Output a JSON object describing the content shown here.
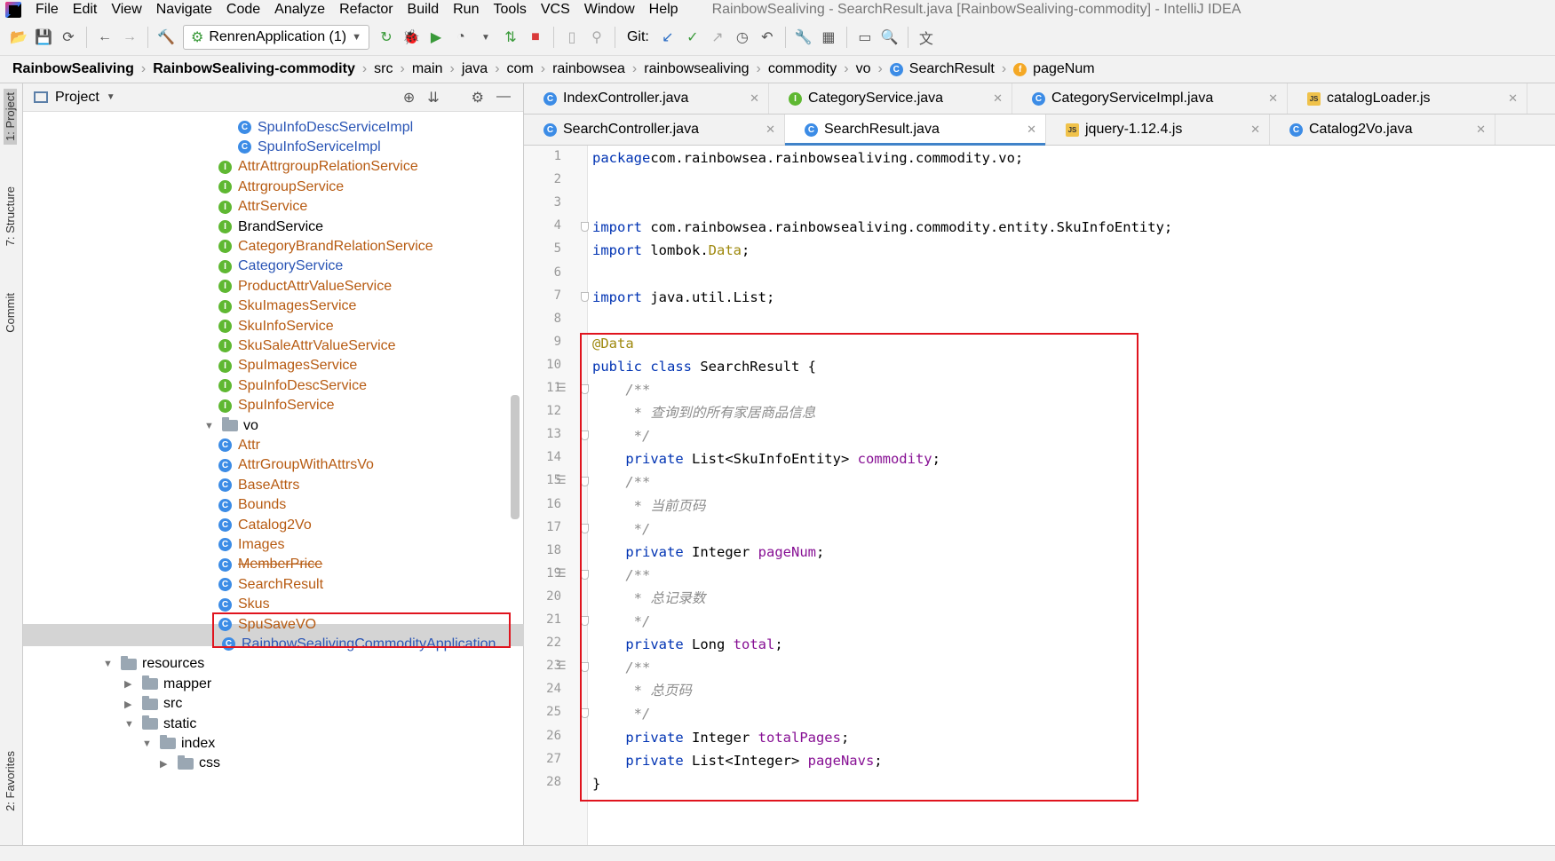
{
  "menubar": {
    "items": [
      "File",
      "Edit",
      "View",
      "Navigate",
      "Code",
      "Analyze",
      "Refactor",
      "Build",
      "Run",
      "Tools",
      "VCS",
      "Window",
      "Help"
    ],
    "window_title": "RainbowSealiving - SearchResult.java [RainbowSealiving-commodity] - IntelliJ IDEA"
  },
  "toolbar": {
    "run_config": "RenrenApplication (1)",
    "git_label": "Git:"
  },
  "breadcrumb": [
    "RainbowSealiving",
    "RainbowSealiving-commodity",
    "src",
    "main",
    "java",
    "com",
    "rainbowsea",
    "rainbowsealiving",
    "commodity",
    "vo",
    "SearchResult",
    "pageNum"
  ],
  "left_tool": {
    "project_tab": "1: Project",
    "structure_tab": "7: Structure",
    "commit_tab": "Commit",
    "favorites_tab": "2: Favorites"
  },
  "project_panel": {
    "title": "Project",
    "tree": [
      {
        "name": "SpuInfoDescServiceImpl",
        "kind": "class",
        "indent": 3,
        "arrow": ""
      },
      {
        "name": "SpuInfoServiceImpl",
        "kind": "class",
        "indent": 3,
        "arrow": ""
      },
      {
        "name": "AttrAttrgroupRelationService",
        "kind": "interface",
        "indent": 2,
        "arrow": ""
      },
      {
        "name": "AttrgroupService",
        "kind": "interface",
        "indent": 2,
        "arrow": ""
      },
      {
        "name": "AttrService",
        "kind": "interface",
        "indent": 2,
        "arrow": ""
      },
      {
        "name": "BrandService",
        "kind": "interface",
        "indent": 2,
        "arrow": "",
        "color": "black"
      },
      {
        "name": "CategoryBrandRelationService",
        "kind": "interface",
        "indent": 2,
        "arrow": ""
      },
      {
        "name": "CategoryService",
        "kind": "interface",
        "indent": 2,
        "arrow": "",
        "color": "blue"
      },
      {
        "name": "ProductAttrValueService",
        "kind": "interface",
        "indent": 2,
        "arrow": ""
      },
      {
        "name": "SkuImagesService",
        "kind": "interface",
        "indent": 2,
        "arrow": ""
      },
      {
        "name": "SkuInfoService",
        "kind": "interface",
        "indent": 2,
        "arrow": ""
      },
      {
        "name": "SkuSaleAttrValueService",
        "kind": "interface",
        "indent": 2,
        "arrow": ""
      },
      {
        "name": "SpuImagesService",
        "kind": "interface",
        "indent": 2,
        "arrow": ""
      },
      {
        "name": "SpuInfoDescService",
        "kind": "interface",
        "indent": 2,
        "arrow": ""
      },
      {
        "name": "SpuInfoService",
        "kind": "interface",
        "indent": 2,
        "arrow": ""
      },
      {
        "name": "vo",
        "kind": "folder",
        "indent": 1,
        "arrow": "▼"
      },
      {
        "name": "Attr",
        "kind": "class",
        "indent": 2,
        "arrow": ""
      },
      {
        "name": "AttrGroupWithAttrsVo",
        "kind": "class",
        "indent": 2,
        "arrow": ""
      },
      {
        "name": "BaseAttrs",
        "kind": "class",
        "indent": 2,
        "arrow": ""
      },
      {
        "name": "Bounds",
        "kind": "class",
        "indent": 2,
        "arrow": ""
      },
      {
        "name": "Catalog2Vo",
        "kind": "class",
        "indent": 2,
        "arrow": ""
      },
      {
        "name": "Images",
        "kind": "class",
        "indent": 2,
        "arrow": ""
      },
      {
        "name": "MemberPrice",
        "kind": "class",
        "indent": 2,
        "arrow": ""
      },
      {
        "name": "SearchResult",
        "kind": "class",
        "indent": 2,
        "arrow": "",
        "selected": true
      },
      {
        "name": "Skus",
        "kind": "class",
        "indent": 2,
        "arrow": ""
      },
      {
        "name": "SpuSaveVO",
        "kind": "class",
        "indent": 2,
        "arrow": ""
      },
      {
        "name": "RainbowSealivingCommodityApplication",
        "kind": "class",
        "indent": 1,
        "arrow": "",
        "color": "blue"
      },
      {
        "name": "resources",
        "kind": "folder",
        "indent": 0,
        "arrow": "▼",
        "color": "black"
      },
      {
        "name": "mapper",
        "kind": "folder",
        "indent": 1,
        "arrow": "▶",
        "color": "black"
      },
      {
        "name": "src",
        "kind": "folder",
        "indent": 1,
        "arrow": "▶",
        "color": "black"
      },
      {
        "name": "static",
        "kind": "folder",
        "indent": 1,
        "arrow": "▼",
        "color": "black"
      },
      {
        "name": "index",
        "kind": "folder",
        "indent": 2,
        "arrow": "▼",
        "color": "black"
      },
      {
        "name": "css",
        "kind": "folder",
        "indent": 3,
        "arrow": "▶",
        "color": "black"
      }
    ]
  },
  "editor_tabs_row1": [
    {
      "label": "IndexController.java",
      "icon": "class-icon"
    },
    {
      "label": "CategoryService.java",
      "icon": "interface-icon"
    },
    {
      "label": "CategoryServiceImpl.java",
      "icon": "class-icon"
    },
    {
      "label": "catalogLoader.js",
      "icon": "js-icon"
    }
  ],
  "editor_tabs_row2": [
    {
      "label": "SearchController.java",
      "icon": "class-icon"
    },
    {
      "label": "SearchResult.java",
      "icon": "class-icon",
      "active": true
    },
    {
      "label": "jquery-1.12.4.js",
      "icon": "js-icon"
    },
    {
      "label": "Catalog2Vo.java",
      "icon": "class-icon"
    }
  ],
  "code_lines": [
    [
      [
        "kw",
        "package"
      ],
      [
        "",
        "com.rainbowsea.rainbowsealiving.commodity.vo;"
      ]
    ],
    [],
    [],
    [
      [
        "kw",
        "import"
      ],
      [
        "",
        " com.rainbowsea.rainbowsealiving.commodity.entity.SkuInfoEntity;"
      ]
    ],
    [
      [
        "kw",
        "import"
      ],
      [
        "",
        " lombok."
      ],
      [
        "an",
        "Data"
      ],
      [
        "",
        ";"
      ]
    ],
    [],
    [
      [
        "kw",
        "import"
      ],
      [
        "",
        " java.util.List;"
      ]
    ],
    [],
    [
      [
        "an",
        "@Data"
      ]
    ],
    [
      [
        "kw",
        "public class"
      ],
      [
        "",
        " SearchResult {"
      ]
    ],
    [
      [
        "cm",
        "    /**"
      ]
    ],
    [
      [
        "cm",
        "     * 查询到的所有家居商品信息"
      ]
    ],
    [
      [
        "cm",
        "     */"
      ]
    ],
    [
      [
        "kw",
        "    private"
      ],
      [
        "",
        " List<SkuInfoEntity> "
      ],
      [
        "fd",
        "commodity"
      ],
      [
        "",
        ";"
      ]
    ],
    [
      [
        "cm",
        "    /**"
      ]
    ],
    [
      [
        "cm",
        "     * 当前页码"
      ]
    ],
    [
      [
        "cm",
        "     */"
      ]
    ],
    [
      [
        "kw",
        "    private"
      ],
      [
        "",
        " Integer "
      ],
      [
        "fd",
        "pageNum"
      ],
      [
        "",
        ";"
      ]
    ],
    [
      [
        "cm",
        "    /**"
      ]
    ],
    [
      [
        "cm",
        "     * 总记录数"
      ]
    ],
    [
      [
        "cm",
        "     */"
      ]
    ],
    [
      [
        "kw",
        "    private"
      ],
      [
        "",
        " Long "
      ],
      [
        "fd",
        "total"
      ],
      [
        "",
        ";"
      ]
    ],
    [
      [
        "cm",
        "    /**"
      ]
    ],
    [
      [
        "cm",
        "     * 总页码"
      ]
    ],
    [
      [
        "cm",
        "     */"
      ]
    ],
    [
      [
        "kw",
        "    private"
      ],
      [
        "",
        " Integer "
      ],
      [
        "fd",
        "totalPages"
      ],
      [
        "",
        ";"
      ]
    ],
    [
      [
        "kw",
        "    private"
      ],
      [
        "",
        " List<Integer> "
      ],
      [
        "fd",
        "pageNavs"
      ],
      [
        "",
        ";"
      ]
    ],
    [
      [
        "",
        "}"
      ]
    ]
  ],
  "line_numbers": [
    "1",
    "2",
    "3",
    "4",
    "5",
    "6",
    "7",
    "8",
    "9",
    "10",
    "11",
    "12",
    "13",
    "14",
    "15",
    "16",
    "17",
    "18",
    "19",
    "20",
    "21",
    "22",
    "23",
    "24",
    "25",
    "26",
    "27",
    "28"
  ],
  "colors": {
    "highlight_box": "#e0141e",
    "keyword": "#0033b3",
    "annotation": "#9e880d",
    "field": "#871094",
    "comment": "#8c8c8c"
  }
}
